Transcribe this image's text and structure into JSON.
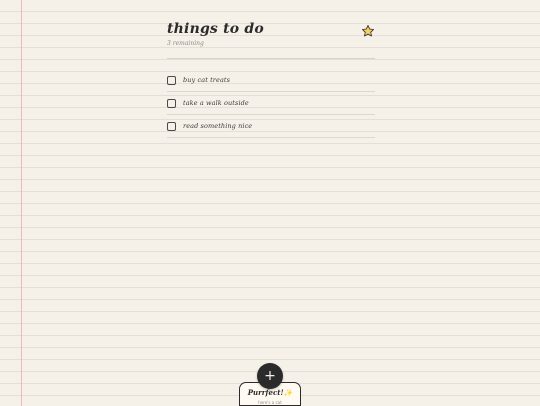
{
  "header": {
    "title": "things to do",
    "subtitle": "3 remaining",
    "star_icon": "star-icon"
  },
  "todos": [
    {
      "label": "buy cat treats",
      "checked": false
    },
    {
      "label": "take a walk outside",
      "checked": false
    },
    {
      "label": "read something nice",
      "checked": false
    }
  ],
  "fab": {
    "label": "+",
    "icon": "plus-icon"
  },
  "toast": {
    "title": "Purrfect!✨",
    "subtitle": "here's a cat"
  },
  "colors": {
    "background": "#f6f1e8",
    "ink": "#2b2b2b",
    "margin_line": "#e9bcbc",
    "rule_line": "#e4dfd6",
    "star_fill": "#f2cf67"
  }
}
